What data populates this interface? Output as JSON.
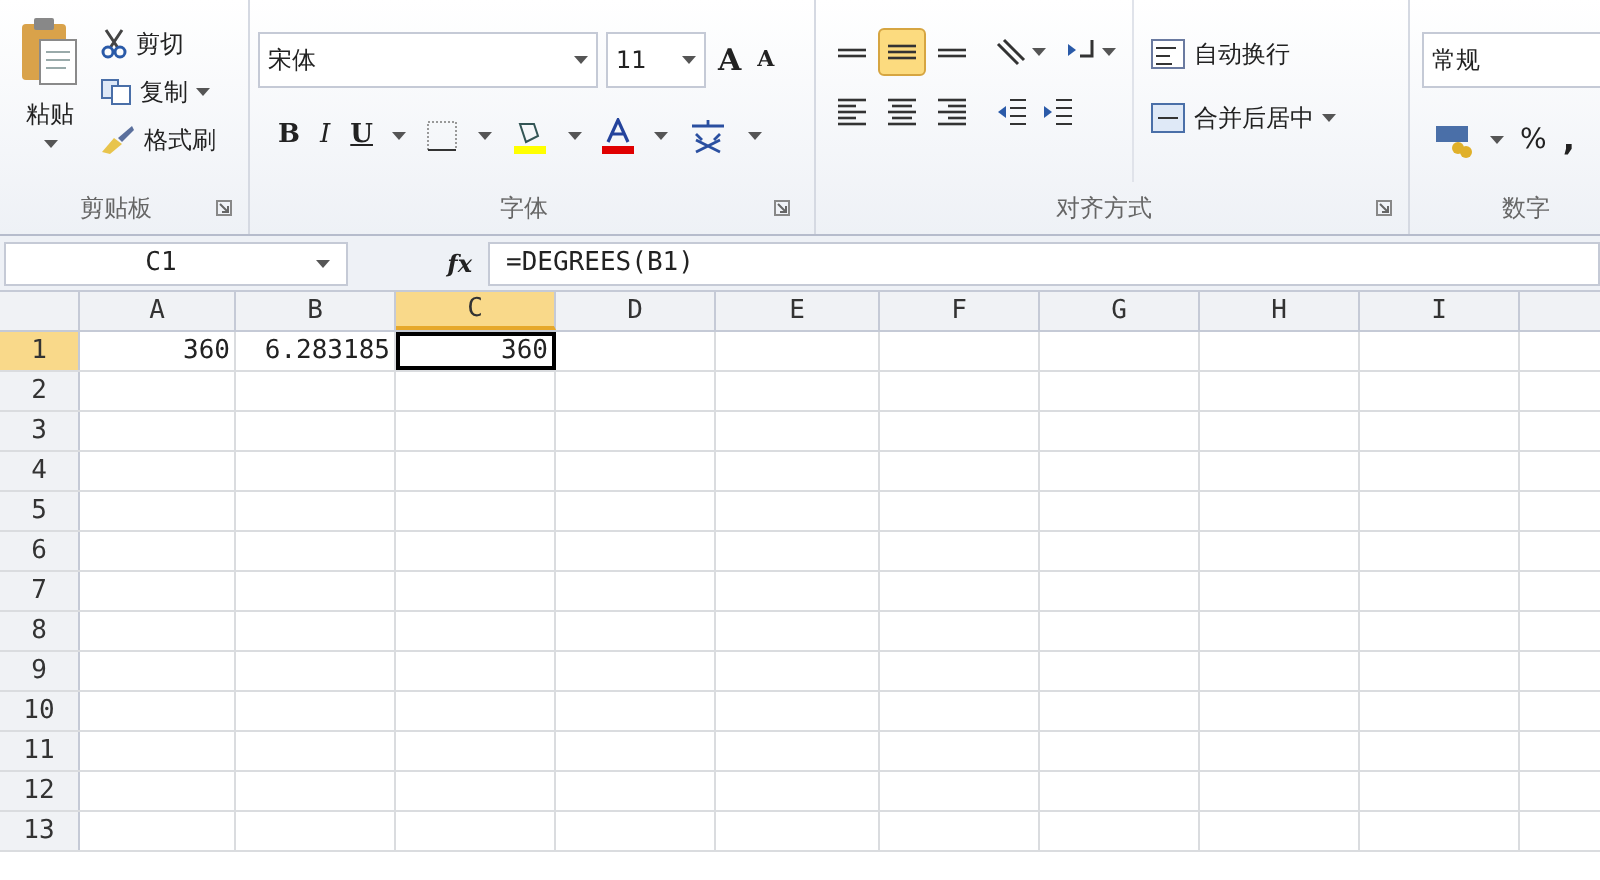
{
  "ribbon": {
    "clipboard": {
      "label": "剪贴板",
      "paste": "粘贴",
      "items": [
        {
          "kind": "cut",
          "label": "剪切",
          "dropdown": false
        },
        {
          "kind": "copy",
          "label": "复制",
          "dropdown": true
        },
        {
          "kind": "painter",
          "label": "格式刷",
          "dropdown": false
        }
      ]
    },
    "font": {
      "label": "字体",
      "font_name": "宋体",
      "font_size": "11",
      "grow": "A",
      "shrink": "A",
      "styles": [
        {
          "kind": "bold",
          "label": "B"
        },
        {
          "kind": "italic",
          "label": "I"
        },
        {
          "kind": "underline",
          "label": "U"
        }
      ]
    },
    "alignment": {
      "label": "对齐方式",
      "vertical": [
        {
          "kind": "top",
          "selected": false
        },
        {
          "kind": "middle",
          "selected": true
        },
        {
          "kind": "bottom",
          "selected": false
        }
      ],
      "wrap_text": "自动换行",
      "merge_center": "合并后居中"
    },
    "number": {
      "label": "数字",
      "format": "常规",
      "percent": "%",
      "comma": ","
    }
  },
  "formula_bar": {
    "name_box": "C1",
    "fx": "fx",
    "formula": "=DEGREES(B1)"
  },
  "sheet": {
    "columns": [
      {
        "label": "A",
        "selected": false
      },
      {
        "label": "B",
        "selected": false
      },
      {
        "label": "C",
        "selected": true
      },
      {
        "label": "D",
        "selected": false
      },
      {
        "label": "E",
        "selected": false
      },
      {
        "label": "F",
        "selected": false
      },
      {
        "label": "G",
        "selected": false
      },
      {
        "label": "H",
        "selected": false
      },
      {
        "label": "I",
        "selected": false
      }
    ],
    "rows": [
      {
        "label": "1",
        "selected": true,
        "cells": [
          {
            "text": "360",
            "active": false
          },
          {
            "text": "6.283185",
            "active": false
          },
          {
            "text": "360",
            "active": true
          }
        ]
      },
      {
        "label": "2",
        "selected": false,
        "cells": []
      },
      {
        "label": "3",
        "selected": false,
        "cells": []
      },
      {
        "label": "4",
        "selected": false,
        "cells": []
      },
      {
        "label": "5",
        "selected": false,
        "cells": []
      },
      {
        "label": "6",
        "selected": false,
        "cells": []
      },
      {
        "label": "7",
        "selected": false,
        "cells": []
      },
      {
        "label": "8",
        "selected": false,
        "cells": []
      },
      {
        "label": "9",
        "selected": false,
        "cells": []
      },
      {
        "label": "10",
        "selected": false,
        "cells": []
      },
      {
        "label": "11",
        "selected": false,
        "cells": []
      },
      {
        "label": "12",
        "selected": false,
        "cells": []
      },
      {
        "label": "13",
        "selected": false,
        "cells": []
      }
    ]
  }
}
